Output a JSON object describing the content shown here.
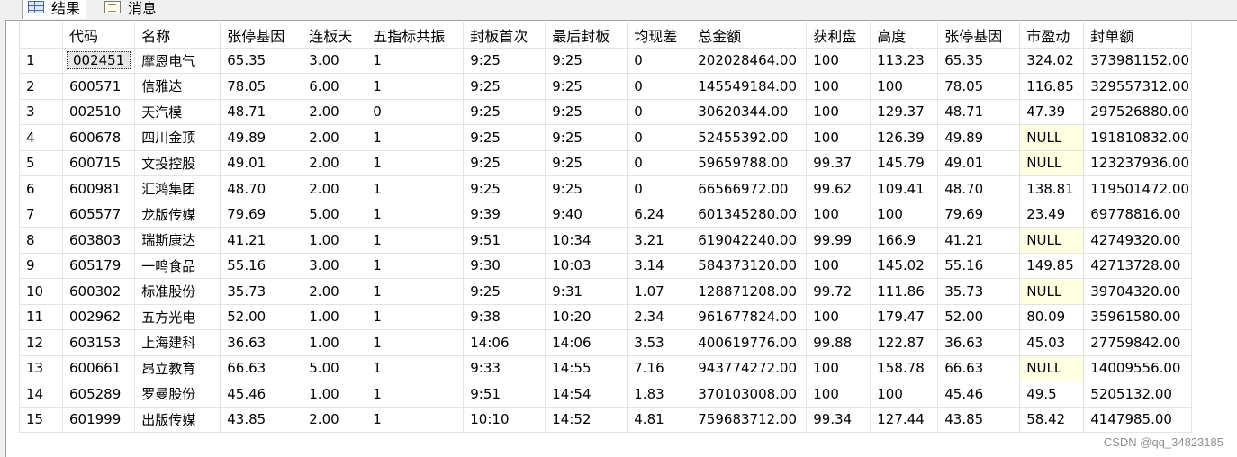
{
  "tabs": [
    {
      "label": "结果",
      "icon": "grid-icon"
    },
    {
      "label": "消息",
      "icon": "message-icon"
    }
  ],
  "columns": [
    "",
    "代码",
    "名称",
    "张停基因",
    "连板天",
    "五指标共振",
    "封板首次",
    "最后封板",
    "均现差",
    "总金额",
    "获利盘",
    "高度",
    "张停基因",
    "市盈动",
    "封单额"
  ],
  "rows": [
    [
      "1",
      "002451",
      "摩恩电气",
      "65.35",
      "3.00",
      "1",
      "9:25",
      "9:25",
      "0",
      "202028464.00",
      "100",
      "113.23",
      "65.35",
      "324.02",
      "373981152.00"
    ],
    [
      "2",
      "600571",
      "信雅达",
      "78.05",
      "6.00",
      "1",
      "9:25",
      "9:25",
      "0",
      "145549184.00",
      "100",
      "100",
      "78.05",
      "116.85",
      "329557312.00"
    ],
    [
      "3",
      "002510",
      "天汽模",
      "48.71",
      "2.00",
      "0",
      "9:25",
      "9:25",
      "0",
      "30620344.00",
      "100",
      "129.37",
      "48.71",
      "47.39",
      "297526880.00"
    ],
    [
      "4",
      "600678",
      "四川金顶",
      "49.89",
      "2.00",
      "1",
      "9:25",
      "9:25",
      "0",
      "52455392.00",
      "100",
      "126.39",
      "49.89",
      "NULL",
      "191810832.00"
    ],
    [
      "5",
      "600715",
      "文投控股",
      "49.01",
      "2.00",
      "1",
      "9:25",
      "9:25",
      "0",
      "59659788.00",
      "99.37",
      "145.79",
      "49.01",
      "NULL",
      "123237936.00"
    ],
    [
      "6",
      "600981",
      "汇鸿集团",
      "48.70",
      "2.00",
      "1",
      "9:25",
      "9:25",
      "0",
      "66566972.00",
      "99.62",
      "109.41",
      "48.70",
      "138.81",
      "119501472.00"
    ],
    [
      "7",
      "605577",
      "龙版传媒",
      "79.69",
      "5.00",
      "1",
      "9:39",
      "9:40",
      "6.24",
      "601345280.00",
      "100",
      "100",
      "79.69",
      "23.49",
      "69778816.00"
    ],
    [
      "8",
      "603803",
      "瑞斯康达",
      "41.21",
      "1.00",
      "1",
      "9:51",
      "10:34",
      "3.21",
      "619042240.00",
      "99.99",
      "166.9",
      "41.21",
      "NULL",
      "42749320.00"
    ],
    [
      "9",
      "605179",
      "一鸣食品",
      "55.16",
      "3.00",
      "1",
      "9:30",
      "10:03",
      "3.14",
      "584373120.00",
      "100",
      "145.02",
      "55.16",
      "149.85",
      "42713728.00"
    ],
    [
      "10",
      "600302",
      "标准股份",
      "35.73",
      "2.00",
      "1",
      "9:25",
      "9:31",
      "1.07",
      "128871208.00",
      "99.72",
      "111.86",
      "35.73",
      "NULL",
      "39704320.00"
    ],
    [
      "11",
      "002962",
      "五方光电",
      "52.00",
      "1.00",
      "1",
      "9:38",
      "10:20",
      "2.34",
      "961677824.00",
      "100",
      "179.47",
      "52.00",
      "80.09",
      "35961580.00"
    ],
    [
      "12",
      "603153",
      "上海建科",
      "36.63",
      "1.00",
      "1",
      "14:06",
      "14:06",
      "3.53",
      "400619776.00",
      "99.88",
      "122.87",
      "36.63",
      "45.03",
      "27759842.00"
    ],
    [
      "13",
      "600661",
      "昂立教育",
      "66.63",
      "5.00",
      "1",
      "9:33",
      "14:55",
      "7.16",
      "943774272.00",
      "100",
      "158.78",
      "66.63",
      "NULL",
      "14009556.00"
    ],
    [
      "14",
      "605289",
      "罗曼股份",
      "45.46",
      "1.00",
      "1",
      "9:51",
      "14:54",
      "1.83",
      "370103008.00",
      "100",
      "100",
      "45.46",
      "49.5",
      "5205132.00"
    ],
    [
      "15",
      "601999",
      "出版传媒",
      "43.85",
      "2.00",
      "1",
      "10:10",
      "14:52",
      "4.81",
      "759683712.00",
      "99.34",
      "127.44",
      "43.85",
      "58.42",
      "4147985.00"
    ]
  ],
  "watermark": "CSDN @qq_34823185"
}
